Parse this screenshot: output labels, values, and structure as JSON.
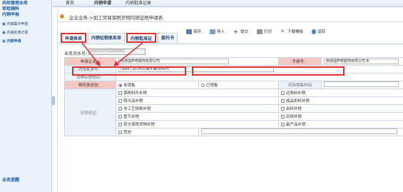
{
  "sidebar": {
    "items": [
      {
        "label": "风险管理业务"
      },
      {
        "label": "审批辅料"
      },
      {
        "label": "内销申报"
      }
    ],
    "sub": [
      {
        "label": "内销集中申报"
      },
      {
        "label": "内销批准记录"
      },
      {
        "label": "内销申请"
      }
    ],
    "bottom": "业务提醒"
  },
  "topbar": {
    "tabs": [
      "首页",
      "内销申请",
      "内销批准记录"
    ]
  },
  "main": {
    "title": "企业业务->加工贸易保税货物内销征税申请表"
  },
  "toolbar": {
    "save": "保存",
    "import": "导入",
    "submit": "提交",
    "print": "打印",
    "download": "下载模板",
    "back": "返回"
  },
  "formtabs": [
    "申请表单",
    "内销征税联系单",
    "内销批准证",
    "委托书"
  ],
  "serial": {
    "label": "业务流水号：",
    "value": "D20150722000001"
  },
  "form": {
    "applicant_label": "申请企业：",
    "applicant_value": "南通温萨奇服饰有限公司",
    "manual_label": "手册号：",
    "manual_value": "南通温萨奇服饰有限公司 B",
    "approval_label": "内销批准号：",
    "approval_value": "(xiao (2014)内销字第0049号",
    "location_label": "货物存放地点：",
    "status_label": "物存放状态：",
    "status_opt1": "未销售",
    "status_opt2": "已销售",
    "actual_sale_label": "实际销售时间",
    "reason_label": "征税原因：",
    "reasons": [
      [
        "保税料件补税",
        "边角料补税"
      ],
      [
        "残次品补税",
        "成品折料补税"
      ],
      [
        "非工艺损耗补税",
        "余料补税"
      ],
      [
        "盘亏补税",
        "后续补税"
      ],
      [
        "受灾保税货物补税",
        "副产品补税"
      ],
      [
        "其他",
        ""
      ]
    ]
  }
}
